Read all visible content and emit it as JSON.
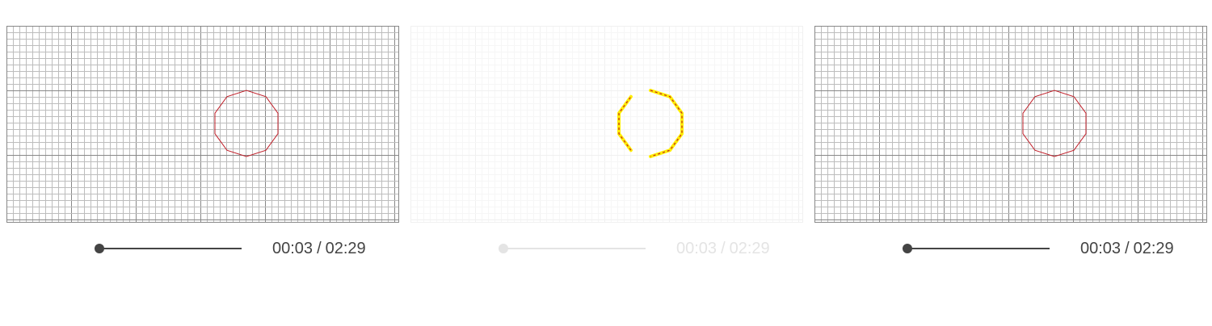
{
  "players": [
    {
      "id": "left",
      "state": "active",
      "progress_fraction": 0.02,
      "time": {
        "current": "00:03",
        "separator": "/",
        "total": "02:29"
      },
      "colors": {
        "control": "#444444",
        "grid_major": "#888888",
        "grid_minor": "#bdbdbd",
        "shape": "#c0202a"
      }
    },
    {
      "id": "center",
      "state": "faded",
      "progress_fraction": 0.02,
      "time": {
        "current": "00:03",
        "separator": "/",
        "total": "02:29"
      },
      "colors": {
        "control": "#e4e4e4",
        "grid_major": "#f0f0f0",
        "grid_minor": "#f6f6f6",
        "shape": "#c0202a",
        "highlight": "#ffee00"
      }
    },
    {
      "id": "right",
      "state": "active",
      "progress_fraction": 0.02,
      "time": {
        "current": "00:03",
        "separator": "/",
        "total": "02:29"
      },
      "colors": {
        "control": "#444444",
        "grid_major": "#888888",
        "grid_minor": "#bdbdbd",
        "shape": "#c0202a"
      }
    }
  ]
}
